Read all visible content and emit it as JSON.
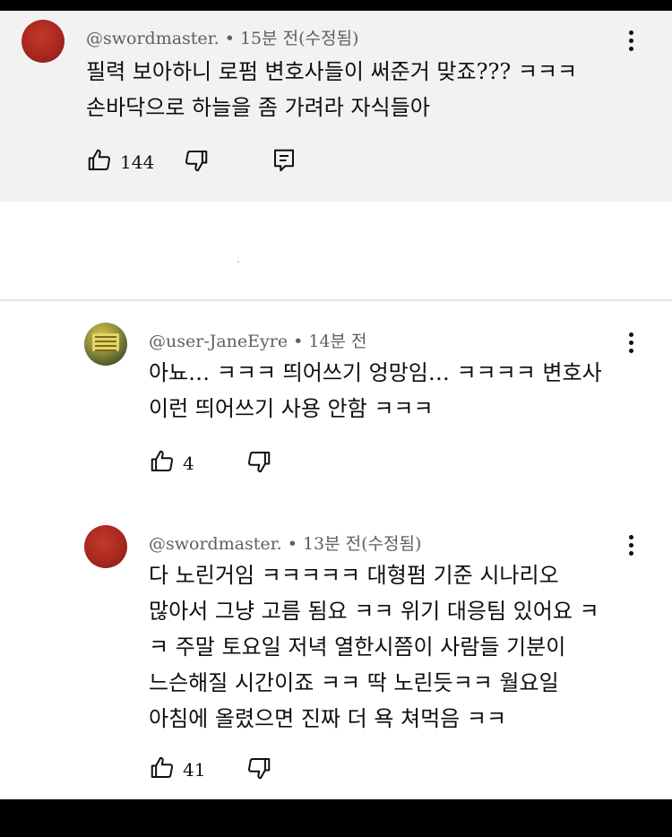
{
  "comments": [
    {
      "author": "@swordmaster.",
      "time": "15분 전(수정됨)",
      "lines": [
        "필력 보아하니 로펌 변호사들이 써준거 맞죠??? ㅋㅋㅋ",
        "손바닥으로 하늘을 좀 가려라 자식들아"
      ],
      "likes": "144",
      "avatar_color": "#a8281f"
    },
    {
      "author": "@user-JaneEyre",
      "time": "14분 전",
      "lines": [
        "아뇨… ㅋㅋㅋ 띄어쓰기 엉망임… ㅋㅋㅋㅋ 변호사",
        "이런 띄어쓰기 사용 안함 ㅋㅋㅋ"
      ],
      "likes": "4"
    },
    {
      "author": "@swordmaster.",
      "time": "13분 전(수정됨)",
      "lines": [
        "다 노린거임 ㅋㅋㅋㅋㅋ 대형펌 기준 시나리오",
        "많아서 그냥 고름 됨요 ㅋㅋ 위기 대응팀 있어요 ㅋ",
        "ㅋ 주말 토요일 저녁 열한시쯤이 사람들 기분이",
        "느슨해질 시간이죠 ㅋㅋ 딱 노린듯ㅋㅋ 월요일",
        "아침에 올렸으면 진짜 더 욕 쳐먹음 ㅋㅋ"
      ],
      "likes": "41"
    }
  ],
  "icons": {
    "like": "thumbs-up-icon",
    "dislike": "thumbs-down-icon",
    "reply": "reply-comment-icon",
    "more": "more-vertical-icon"
  },
  "colors": {
    "highlight_bg": "#f2f2f2",
    "meta_text": "#606060"
  }
}
